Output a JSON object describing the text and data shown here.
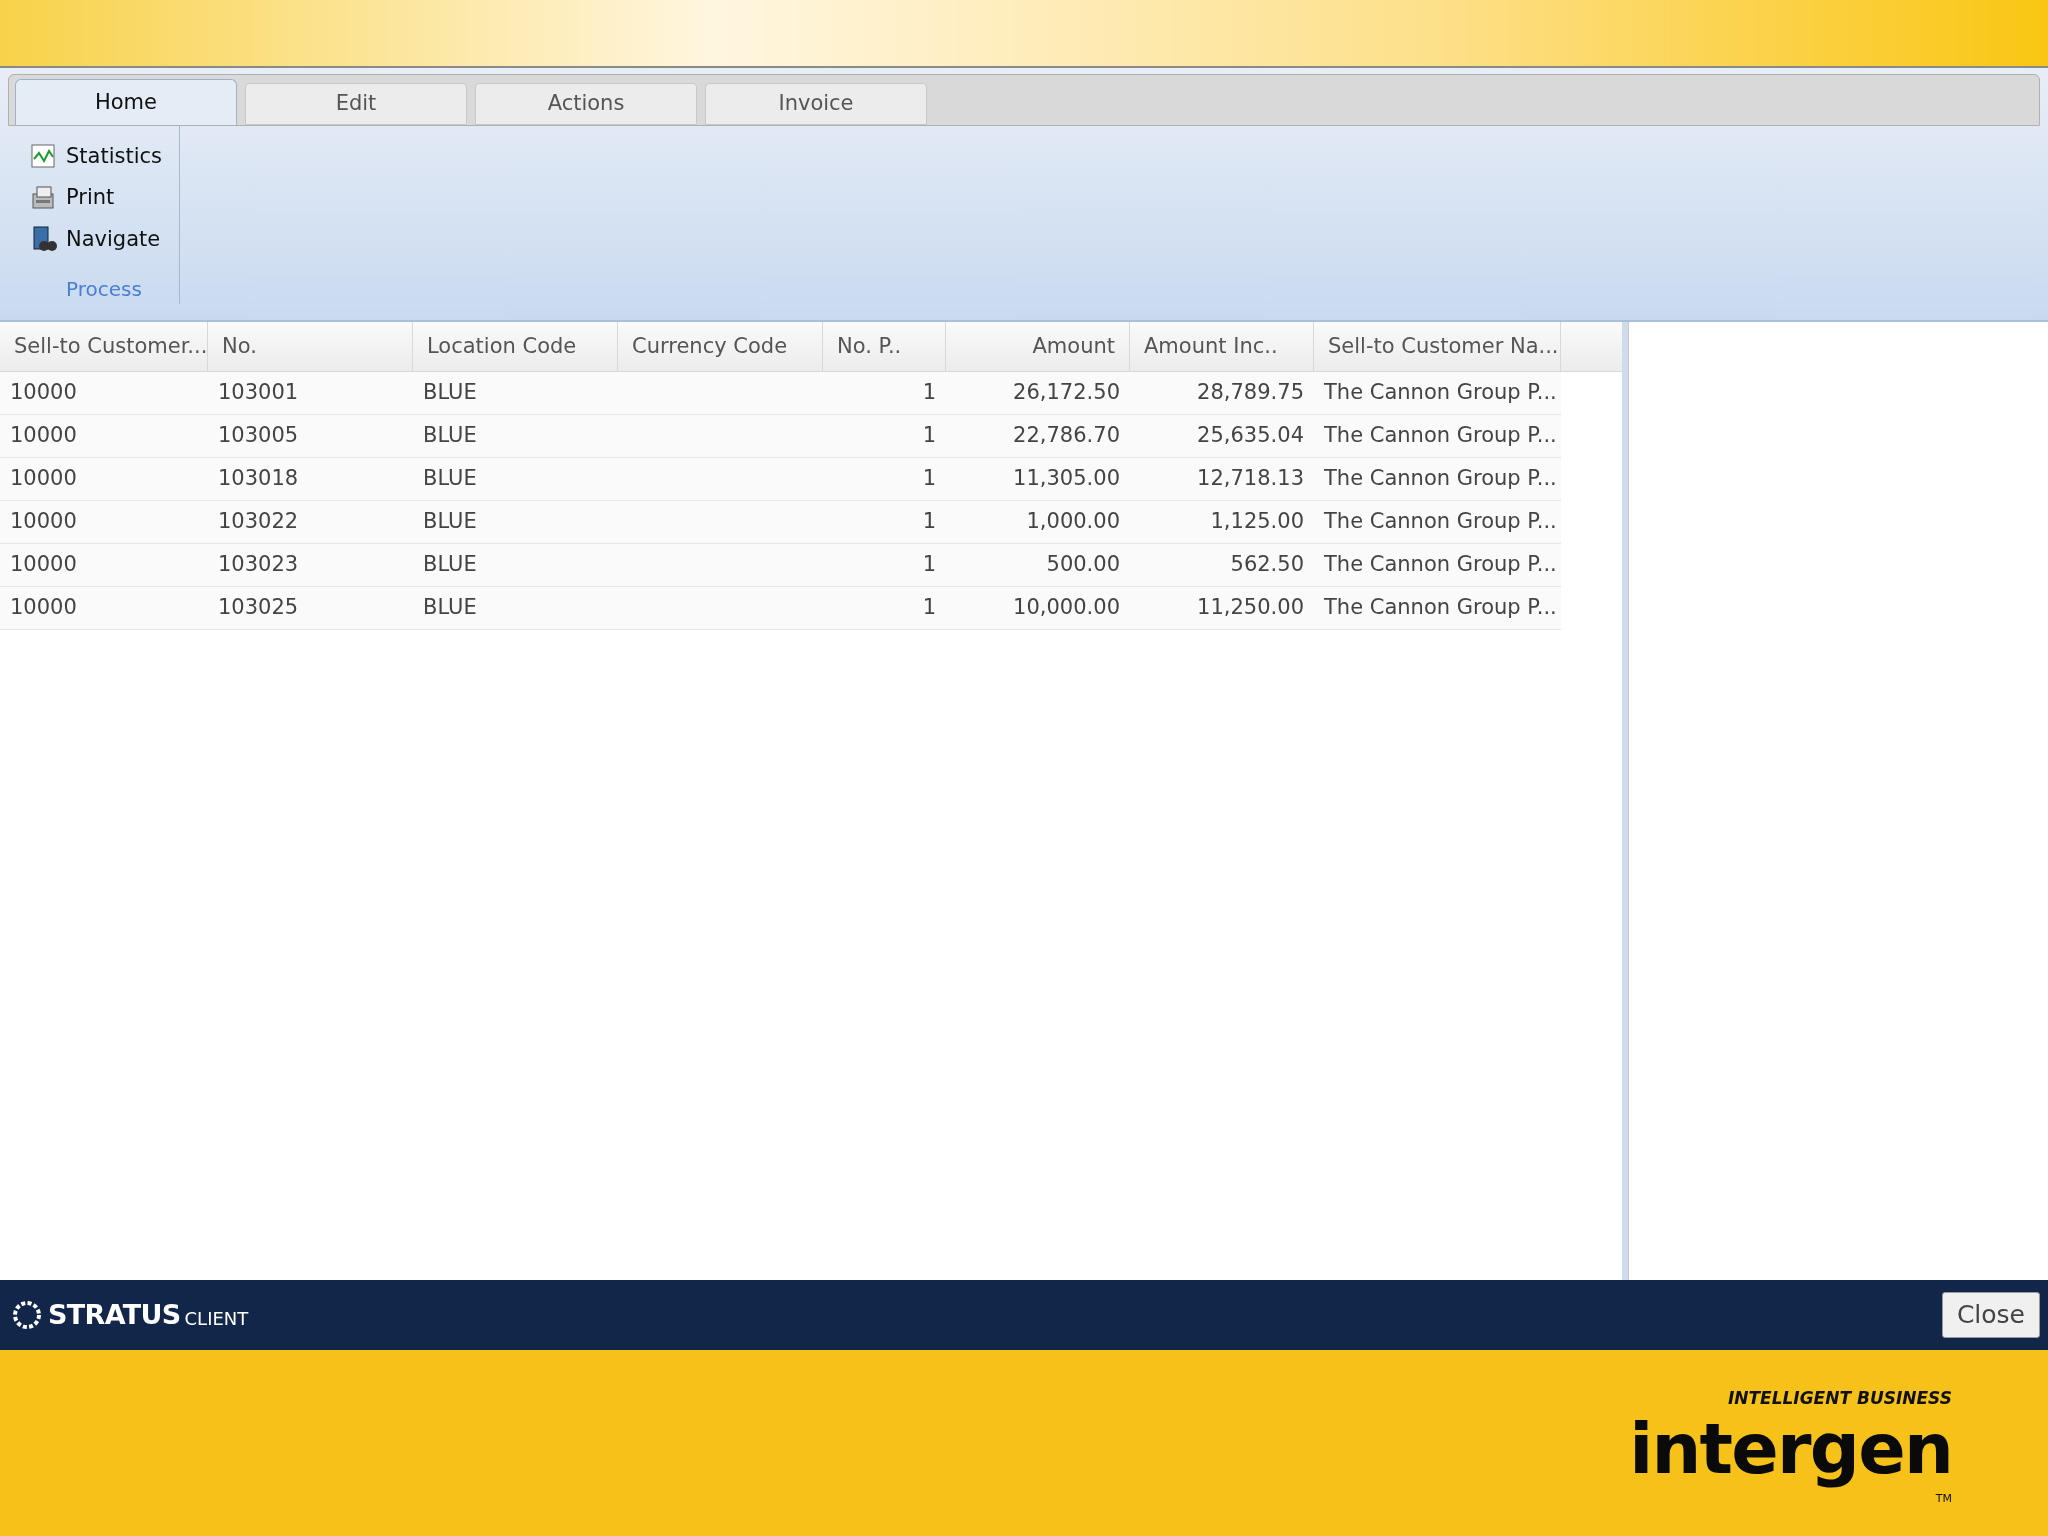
{
  "tabs": [
    {
      "label": "Home",
      "selected": true
    },
    {
      "label": "Edit",
      "selected": false
    },
    {
      "label": "Actions",
      "selected": false
    },
    {
      "label": "Invoice",
      "selected": false
    }
  ],
  "ribbon": {
    "group_label": "Process",
    "items": [
      {
        "kind": "chart",
        "label": "Statistics"
      },
      {
        "kind": "printer",
        "label": "Print"
      },
      {
        "kind": "navigate",
        "label": "Navigate"
      }
    ]
  },
  "table": {
    "columns": [
      {
        "label": "Sell-to Customer..."
      },
      {
        "label": "No."
      },
      {
        "label": "Location Code"
      },
      {
        "label": "Currency Code"
      },
      {
        "label": "No. P.."
      },
      {
        "label": "Amount"
      },
      {
        "label": "Amount Inc.."
      },
      {
        "label": "Sell-to Customer Na..."
      }
    ],
    "rows": [
      [
        "10000",
        "103001",
        "BLUE",
        "",
        "1",
        "26,172.50",
        "28,789.75",
        "The Cannon Group P..."
      ],
      [
        "10000",
        "103005",
        "BLUE",
        "",
        "1",
        "22,786.70",
        "25,635.04",
        "The Cannon Group P..."
      ],
      [
        "10000",
        "103018",
        "BLUE",
        "",
        "1",
        "11,305.00",
        "12,718.13",
        "The Cannon Group P..."
      ],
      [
        "10000",
        "103022",
        "BLUE",
        "",
        "1",
        "1,000.00",
        "1,125.00",
        "The Cannon Group P..."
      ],
      [
        "10000",
        "103023",
        "BLUE",
        "",
        "1",
        "500.00",
        "562.50",
        "The Cannon Group P..."
      ],
      [
        "10000",
        "103025",
        "BLUE",
        "",
        "1",
        "10,000.00",
        "11,250.00",
        "The Cannon Group P..."
      ]
    ]
  },
  "footer": {
    "brand": "STRATUS",
    "brand_suffix": "CLIENT",
    "close_button": "Close"
  },
  "logo": {
    "tagline": "INTELLIGENT BUSINESS",
    "name": "intergen",
    "trademark": "TM"
  }
}
